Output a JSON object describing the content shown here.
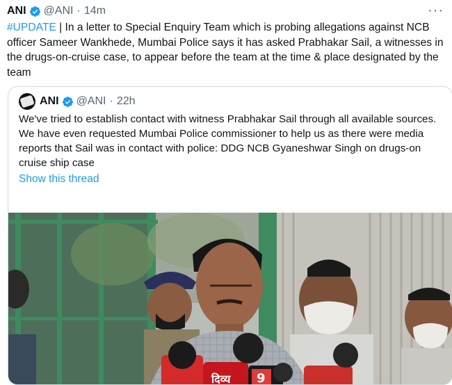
{
  "tweet": {
    "author_name": "ANI",
    "handle": "@ANI",
    "separator": "·",
    "time": "14m",
    "hashtag": "#UPDATE",
    "text": " | In a letter to Special Enquiry Team which is probing allegations against NCB officer Sameer Wankhede, Mumbai Police says it has asked Prabhakar Sail, a witnesses in the drugs-on-cruise case, to appear before the team at the time & place designated by the team",
    "more_label": "···"
  },
  "quoted_tweet": {
    "author_name": "ANI",
    "handle": "@ANI",
    "separator": "·",
    "time": "22h",
    "text": "We've tried to establish contact with witness Prabhakar Sail through all available sources. We have even requested Mumbai Police commissioner to help us as there were media reports that Sail was in contact with police: DDG NCB Gyaneshwar Singh on drugs-on cruise ship case",
    "show_thread_label": "Show this thread"
  },
  "media": {
    "mic_label_1": "दिव्य",
    "mic_label_2": "9"
  },
  "colors": {
    "accent": "#1d9bf0",
    "secondary_text": "#536471",
    "border": "#cfd9de"
  }
}
